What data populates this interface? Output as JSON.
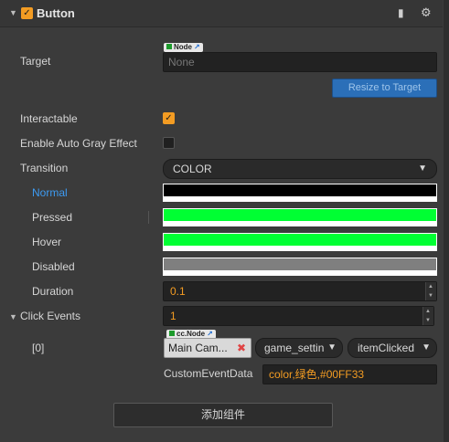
{
  "header": {
    "title": "Button",
    "enabled": true
  },
  "target": {
    "label": "Target",
    "tag": "Node",
    "placeholder": "None"
  },
  "resize_label": "Resize to Target",
  "interactable": {
    "label": "Interactable",
    "checked": true
  },
  "gray": {
    "label": "Enable Auto Gray Effect",
    "checked": false
  },
  "transition": {
    "label": "Transition",
    "value": "COLOR"
  },
  "colors": [
    {
      "label": "Normal",
      "color": "#000000"
    },
    {
      "label": "Pressed",
      "color": "#00FF33"
    },
    {
      "label": "Hover",
      "color": "#00FF33"
    },
    {
      "label": "Disabled",
      "color": "#7F7F7F"
    }
  ],
  "duration": {
    "label": "Duration",
    "value": "0.1"
  },
  "click_events": {
    "label": "Click Events",
    "count": "1"
  },
  "event0": {
    "index": "[0]",
    "tag": "cc.Node",
    "node": "Main Cam...",
    "component": "game_settin",
    "handler": "itemClicked"
  },
  "custom": {
    "label": "CustomEventData",
    "value": "color,绿色,#00FF33"
  },
  "add_component": "添加组件",
  "icons": {
    "collapse": "triangle-down-icon",
    "book": "book-icon",
    "gear": "gear-icon",
    "link": "external-link-icon",
    "remove": "close-icon"
  },
  "accent": "#f39c23"
}
